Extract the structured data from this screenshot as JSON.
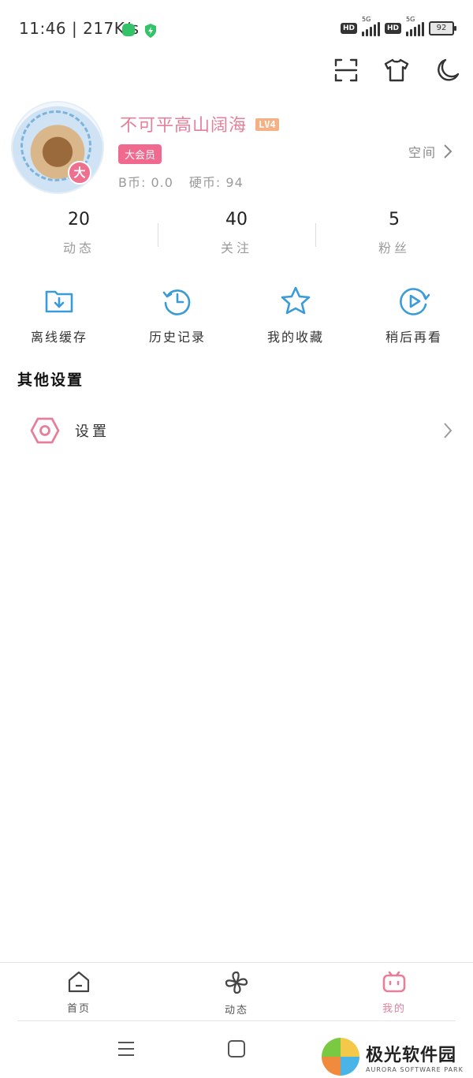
{
  "status_bar": {
    "time_speed": "11:46 | 217K/s",
    "hd_label": "HD",
    "network_label": "5G",
    "battery": "92"
  },
  "toolbar": {
    "scan_icon": "scan-icon",
    "theme_icon": "tshirt-icon",
    "night_icon": "moon-icon"
  },
  "profile": {
    "username": "不可平高山阔海",
    "level": "LV4",
    "vip_tag": "大会员",
    "vip_badge": "大",
    "b_coin": "B币: 0.0",
    "coin": "硬币: 94",
    "space_label": "空间"
  },
  "stats": [
    {
      "value": "20",
      "label": "动态"
    },
    {
      "value": "40",
      "label": "关注"
    },
    {
      "value": "5",
      "label": "粉丝"
    }
  ],
  "quick_actions": [
    {
      "label": "离线缓存",
      "icon": "download-folder-icon"
    },
    {
      "label": "历史记录",
      "icon": "history-icon"
    },
    {
      "label": "我的收藏",
      "icon": "star-icon"
    },
    {
      "label": "稍后再看",
      "icon": "watch-later-icon"
    }
  ],
  "other_settings": {
    "title": "其他设置",
    "settings_label": "设置"
  },
  "bottom_nav": [
    {
      "label": "首页",
      "icon": "home-icon"
    },
    {
      "label": "动态",
      "icon": "pinwheel-icon"
    },
    {
      "label": "我的",
      "icon": "tv-icon",
      "active": true
    }
  ],
  "colors": {
    "accent_pink": "#e57f9a",
    "icon_blue": "#3a9bd8"
  },
  "watermark": {
    "cn": "极光软件园",
    "en": "AURORA SOFTWARE PARK"
  }
}
